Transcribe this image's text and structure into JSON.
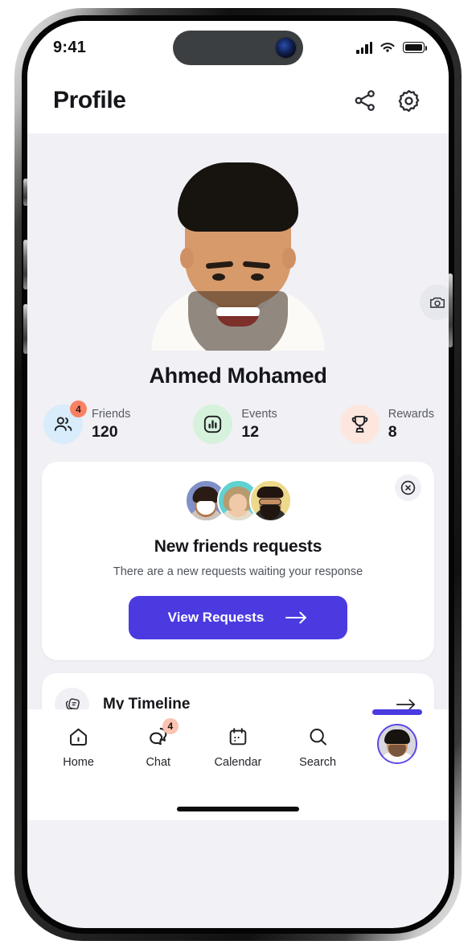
{
  "status_bar": {
    "time": "9:41",
    "signal_icon": "cellular-signal-icon",
    "wifi_icon": "wifi-icon",
    "battery_icon": "battery-icon"
  },
  "header": {
    "title": "Profile",
    "share_icon": "share-icon",
    "settings_icon": "gear-icon"
  },
  "profile": {
    "name": "Ahmed Mohamed",
    "photo_alt": "profile-photo",
    "camera_icon": "camera-icon"
  },
  "stats": [
    {
      "label": "Friends",
      "value": "120",
      "badge": "4",
      "icon": "users-icon",
      "bg": "#d9ecfb"
    },
    {
      "label": "Events",
      "value": "12",
      "badge": "",
      "icon": "chart-icon",
      "bg": "#d6f2dc"
    },
    {
      "label": "Rewards",
      "value": "8",
      "badge": "",
      "icon": "trophy-icon",
      "bg": "#fde6dd"
    }
  ],
  "requests_card": {
    "title": "New friends requests",
    "subtitle": "There are a new requests waiting your response",
    "button_label": "View Requests",
    "button_arrow_icon": "arrow-right-icon",
    "close_icon": "close-circle-icon",
    "avatars": [
      {
        "name": "avatar-masked-person",
        "bg": "#8090c8",
        "skin": "#b4774f",
        "hair": "#2a1c14"
      },
      {
        "name": "avatar-blonde-woman",
        "bg": "#5fd2d2",
        "skin": "#f0c9a8",
        "hair": "#b79a6e"
      },
      {
        "name": "avatar-bearded-man",
        "bg": "#ecd98b",
        "skin": "#c78f62",
        "hair": "#20160f"
      }
    ]
  },
  "timeline": {
    "label": "My Timeline",
    "icon": "cards-stack-icon",
    "arrow_icon": "arrow-right-icon"
  },
  "bottom_nav": {
    "items": [
      {
        "label": "Home",
        "icon": "home-icon",
        "badge": "",
        "active": false
      },
      {
        "label": "Chat",
        "icon": "chat-icon",
        "badge": "4",
        "active": false
      },
      {
        "label": "Calendar",
        "icon": "calendar-icon",
        "badge": "",
        "active": false
      },
      {
        "label": "Search",
        "icon": "search-icon",
        "badge": "",
        "active": false
      }
    ],
    "profile_tab": {
      "label": "",
      "icon": "profile-avatar",
      "active": true
    }
  },
  "colors": {
    "accent": "#4a3ae0",
    "badge_orange": "#fb8163",
    "badge_peach": "#fbc3b2",
    "page_bg": "#f0f0f5",
    "card_bg": "#ffffff",
    "text_primary": "#15161a",
    "text_secondary": "#585a63"
  }
}
